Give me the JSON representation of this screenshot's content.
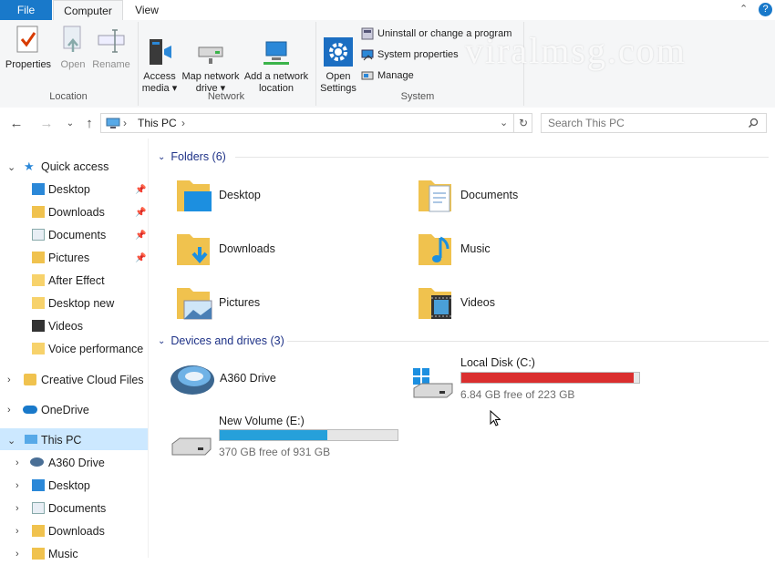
{
  "tabs": {
    "file": "File",
    "computer": "Computer",
    "view": "View"
  },
  "ribbon": {
    "location": {
      "label": "Location",
      "properties": "Properties",
      "open": "Open",
      "rename": "Rename"
    },
    "network": {
      "label": "Network",
      "access_media": "Access\nmedia ▾",
      "map_drive": "Map network\ndrive ▾",
      "add_location": "Add a network\nlocation"
    },
    "system": {
      "label": "System",
      "open_settings": "Open\nSettings",
      "uninstall": "Uninstall or change a program",
      "sys_props": "System properties",
      "manage": "Manage"
    }
  },
  "watermark": "viralmsg.com",
  "address": {
    "path": "This PC",
    "search_placeholder": "Search This PC"
  },
  "sidebar": {
    "quick_access": "Quick access",
    "qa_items": [
      "Desktop",
      "Downloads",
      "Documents",
      "Pictures",
      "After Effect",
      "Desktop new",
      "Videos",
      "Voice performance"
    ],
    "creative_cloud": "Creative Cloud Files",
    "onedrive": "OneDrive",
    "this_pc": "This PC",
    "pc_items": [
      "A360 Drive",
      "Desktop",
      "Documents",
      "Downloads",
      "Music"
    ]
  },
  "content": {
    "folders_header": "Folders (6)",
    "folders": [
      "Desktop",
      "Documents",
      "Downloads",
      "Music",
      "Pictures",
      "Videos"
    ],
    "devices_header": "Devices and drives (3)",
    "a360": "A360 Drive",
    "local_disk": {
      "name": "Local Disk (C:)",
      "free": "6.84 GB free of 223 GB",
      "used_fraction": 0.969,
      "color": "#da2e2e"
    },
    "new_volume": {
      "name": "New Volume (E:)",
      "free": "370 GB free of 931 GB",
      "used_fraction": 0.603,
      "color": "#26a0da"
    }
  }
}
